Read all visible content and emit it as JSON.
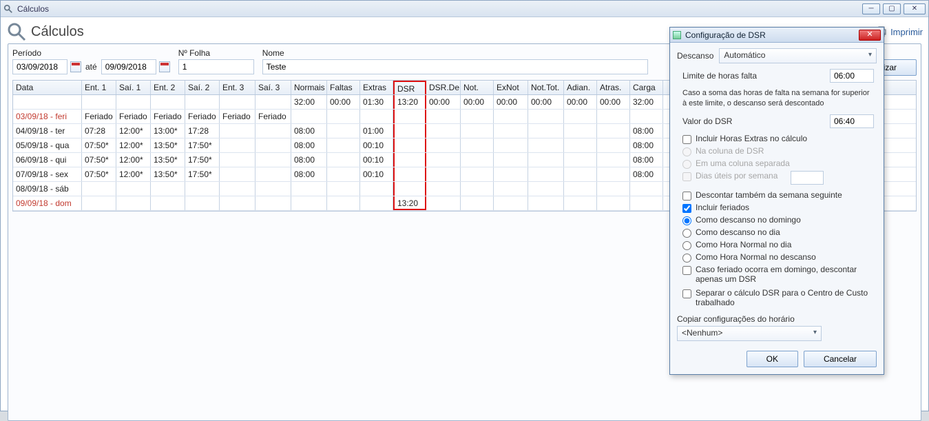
{
  "window": {
    "title": "Cálculos"
  },
  "toolbar": {
    "heading": "Cálculos",
    "print": "Imprimir",
    "atualizar": "Atualizar"
  },
  "buttons": {
    "atualizar": "Atualizar"
  },
  "filters": {
    "periodo_lbl": "Período",
    "data1": "03/09/2018",
    "ate": "até",
    "data2": "09/09/2018",
    "nfolha_lbl": "Nº Folha",
    "nfolha": "1",
    "nome_lbl": "Nome",
    "nome": "Teste"
  },
  "columns": {
    "c0": "Data",
    "c1": "Ent. 1",
    "c2": "Saí. 1",
    "c3": "Ent. 2",
    "c4": "Saí. 2",
    "c5": "Ent. 3",
    "c6": "Saí. 3",
    "c7": "Normais",
    "c8": "Faltas",
    "c9": "Extras",
    "c10": "DSR",
    "c11": "DSR.De",
    "c12": "Not.",
    "c13": "ExNot",
    "c14": "Not.Tot.",
    "c15": "Adian.",
    "c16": "Atras.",
    "c17": "Carga"
  },
  "rows": [
    {
      "d": "",
      "e1": "",
      "s1": "",
      "e2": "",
      "s2": "",
      "e3": "",
      "s3": "",
      "norm": "32:00",
      "falt": "00:00",
      "ext": "01:30",
      "dsr": "13:20",
      "dsrde": "00:00",
      "not": "00:00",
      "exnot": "00:00",
      "nottot": "00:00",
      "adian": "00:00",
      "atras": "00:00",
      "carga": "32:00",
      "red": false,
      "dsrTop": true
    },
    {
      "d": "03/09/18 - feri",
      "e1": "Feriado",
      "s1": "Feriado",
      "e2": "Feriado",
      "s2": "Feriado",
      "e3": "Feriado",
      "s3": "Feriado",
      "norm": "",
      "falt": "",
      "ext": "",
      "dsr": "",
      "dsrde": "",
      "not": "",
      "exnot": "",
      "nottot": "",
      "adian": "",
      "atras": "",
      "carga": "",
      "red": true
    },
    {
      "d": "04/09/18 - ter",
      "e1": "07:28",
      "s1": "12:00*",
      "e2": "13:00*",
      "s2": "17:28",
      "e3": "",
      "s3": "",
      "norm": "08:00",
      "falt": "",
      "ext": "01:00",
      "dsr": "",
      "dsrde": "",
      "not": "",
      "exnot": "",
      "nottot": "",
      "adian": "",
      "atras": "",
      "carga": "08:00",
      "red": false
    },
    {
      "d": "05/09/18 - qua",
      "e1": "07:50*",
      "s1": "12:00*",
      "e2": "13:50*",
      "s2": "17:50*",
      "e3": "",
      "s3": "",
      "norm": "08:00",
      "falt": "",
      "ext": "00:10",
      "dsr": "",
      "dsrde": "",
      "not": "",
      "exnot": "",
      "nottot": "",
      "adian": "",
      "atras": "",
      "carga": "08:00",
      "red": false
    },
    {
      "d": "06/09/18 - qui",
      "e1": "07:50*",
      "s1": "12:00*",
      "e2": "13:50*",
      "s2": "17:50*",
      "e3": "",
      "s3": "",
      "norm": "08:00",
      "falt": "",
      "ext": "00:10",
      "dsr": "",
      "dsrde": "",
      "not": "",
      "exnot": "",
      "nottot": "",
      "adian": "",
      "atras": "",
      "carga": "08:00",
      "red": false
    },
    {
      "d": "07/09/18 - sex",
      "e1": "07:50*",
      "s1": "12:00*",
      "e2": "13:50*",
      "s2": "17:50*",
      "e3": "",
      "s3": "",
      "norm": "08:00",
      "falt": "",
      "ext": "00:10",
      "dsr": "",
      "dsrde": "",
      "not": "",
      "exnot": "",
      "nottot": "",
      "adian": "",
      "atras": "",
      "carga": "08:00",
      "red": false
    },
    {
      "d": "08/09/18 - sáb",
      "e1": "",
      "s1": "",
      "e2": "",
      "s2": "",
      "e3": "",
      "s3": "",
      "norm": "",
      "falt": "",
      "ext": "",
      "dsr": "",
      "dsrde": "",
      "not": "",
      "exnot": "",
      "nottot": "",
      "adian": "",
      "atras": "",
      "carga": "",
      "red": false
    },
    {
      "d": "09/09/18 - dom",
      "e1": "",
      "s1": "",
      "e2": "",
      "s2": "",
      "e3": "",
      "s3": "",
      "norm": "",
      "falt": "",
      "ext": "",
      "dsr": "13:20",
      "dsrde": "",
      "not": "",
      "exnot": "",
      "nottot": "",
      "adian": "",
      "atras": "",
      "carga": "",
      "red": true,
      "dsrBot": true
    }
  ],
  "dlg": {
    "title": "Configuração de DSR",
    "descanso_lbl": "Descanso",
    "descanso_val": "Automático",
    "limite_lbl": "Limite de horas falta",
    "limite_val": "06:00",
    "note": "Caso a soma das horas de falta na semana for superior à este limite, o descanso será descontado",
    "valor_lbl": "Valor do DSR",
    "valor_val": "06:40",
    "chk_extras": "Incluir Horas Extras no cálculo",
    "r_col_dsr": "Na coluna de DSR",
    "r_col_sep": "Em uma coluna separada",
    "chk_dias_uteis": "Dias úteis por semana",
    "chk_descontar": "Descontar também da semana seguinte",
    "chk_feriados": "Incluir feriados",
    "r_f1": "Como descanso no domingo",
    "r_f2": "Como descanso no dia",
    "r_f3": "Como Hora Normal no dia",
    "r_f4": "Como Hora Normal no descanso",
    "chk_caso": "Caso feriado ocorra em domingo, descontar apenas um DSR",
    "chk_separar": "Separar o cálculo DSR para o Centro de Custo trabalhado",
    "copiar_lbl": "Copiar configurações do horário",
    "copiar_val": "<Nenhum>",
    "ok": "OK",
    "cancel": "Cancelar"
  }
}
